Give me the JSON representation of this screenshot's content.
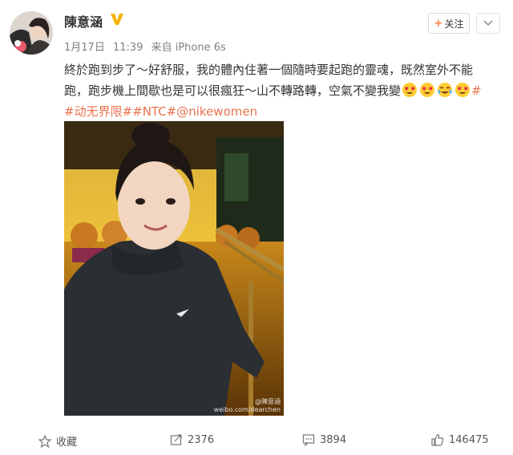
{
  "post": {
    "username": "陳意涵",
    "meta": {
      "date": "1月17日",
      "time": "11:39",
      "source_prefix": "来自",
      "source": "iPhone 6s"
    },
    "follow_label": "关注",
    "text_lines": [
      "終於跑到步了～好舒服，我的體內住著一個隨時要起跑的靈魂，既然室外不能",
      "跑，跑步機上間歇也是可以很瘋狂～山不轉路轉，空氣不變我變"
    ],
    "hashtags": "#动无界限##NTC#@nikewomen",
    "trailing_hash": "#",
    "emojis": [
      "heart-eyes",
      "heart-eyes",
      "tears-of-joy",
      "heart-eyes"
    ],
    "watermark": {
      "name": "@陳意涵",
      "url": "weibo.com/dearchen"
    }
  },
  "actions": {
    "favorite_label": "收藏",
    "repost_count": "2376",
    "comment_count": "3894",
    "like_count": "146475"
  },
  "colors": {
    "tag": "#eb7350",
    "verified": "#f6b100",
    "follow_plus": "#ff8140"
  }
}
